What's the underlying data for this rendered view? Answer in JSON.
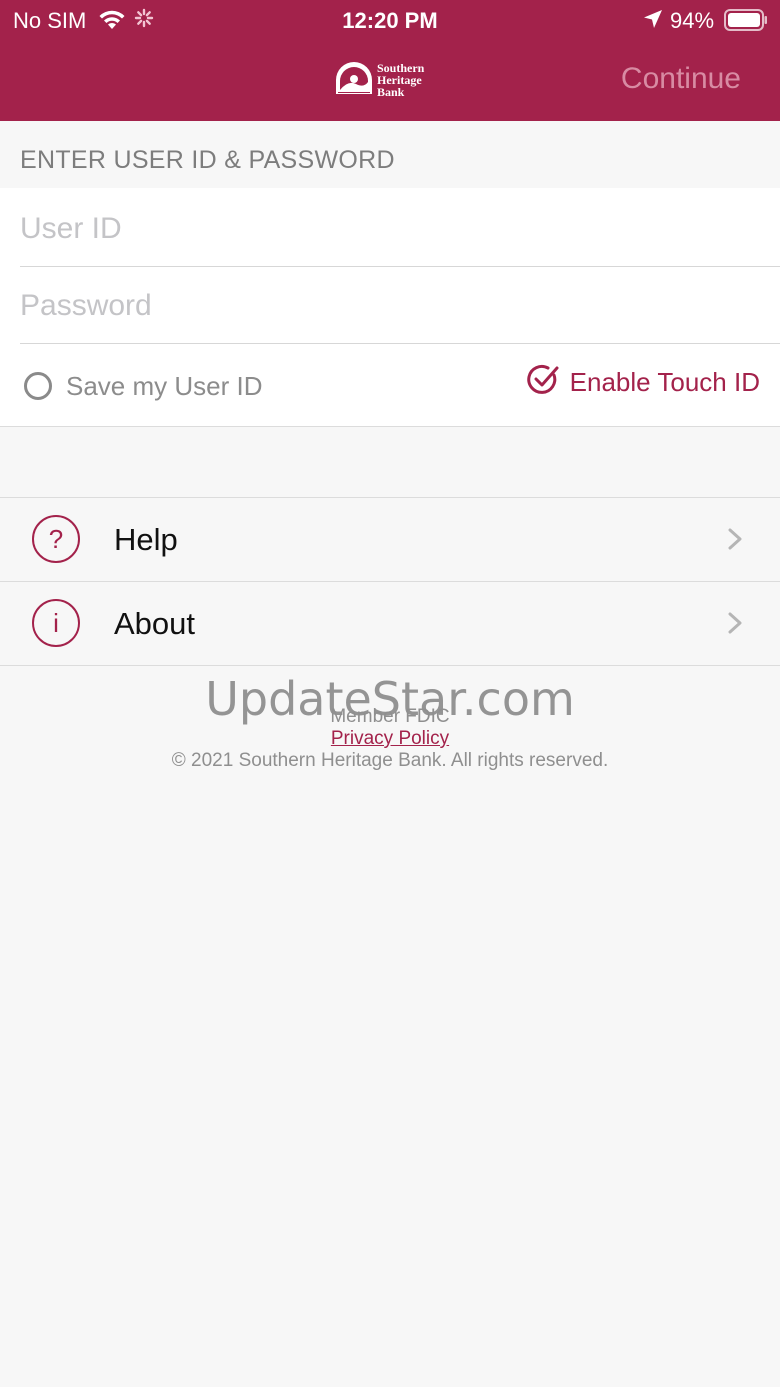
{
  "status_bar": {
    "carrier": "No SIM",
    "time": "12:20 PM",
    "battery": "94%"
  },
  "header": {
    "logo_text": "Southern Heritage Bank",
    "continue_label": "Continue"
  },
  "login": {
    "section_title": "ENTER USER ID & PASSWORD",
    "user_id_placeholder": "User ID",
    "password_placeholder": "Password",
    "save_user_label": "Save my User ID",
    "touch_id_label": "Enable Touch ID"
  },
  "menu": {
    "items": [
      {
        "label": "Help",
        "icon": "question-icon",
        "glyph": "?"
      },
      {
        "label": "About",
        "icon": "info-icon",
        "glyph": "i"
      }
    ]
  },
  "footer": {
    "watermark": "UpdateStar.com",
    "fdic": "Member FDIC",
    "privacy": "Privacy Policy",
    "copyright": "© 2021 Southern Heritage Bank. All rights reserved."
  },
  "colors": {
    "brand": "#a3224b",
    "continue_disabled": "#d88ba3",
    "background": "#f7f7f7"
  }
}
